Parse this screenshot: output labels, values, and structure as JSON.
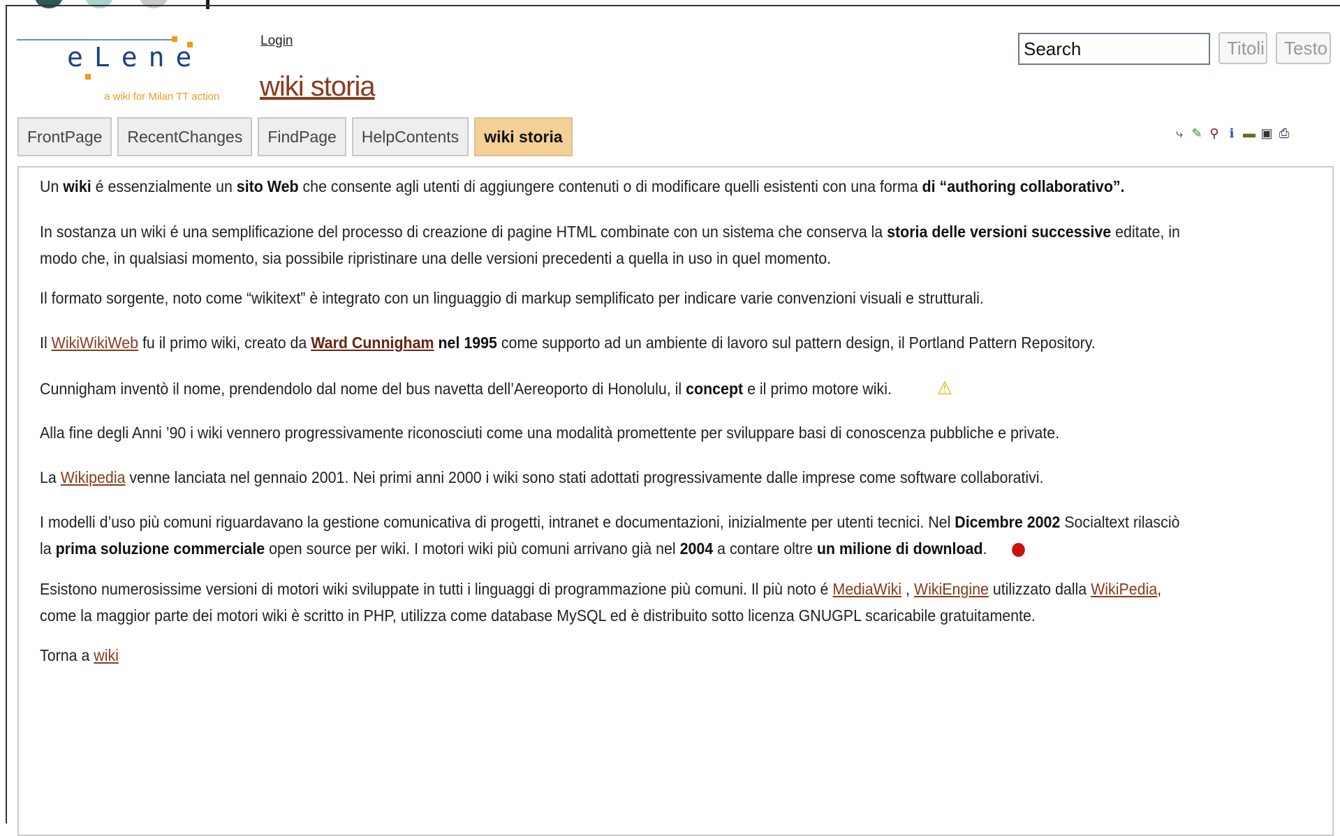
{
  "window": {
    "title": ""
  },
  "header": {
    "logo_text": "eLene",
    "logo_tagline": "a wiki for Milan TT action",
    "login_label": "Login",
    "page_title": "wiki storia"
  },
  "search": {
    "value": "Search",
    "titoli_label": "Titoli",
    "testo_label": "Testo"
  },
  "nav": {
    "tabs": [
      {
        "label": "FrontPage"
      },
      {
        "label": "RecentChanges"
      },
      {
        "label": "FindPage"
      },
      {
        "label": "HelpContents"
      },
      {
        "label": "wiki storia",
        "active": true
      }
    ]
  },
  "toolbar_icons": [
    "subscribe-icon",
    "edit-icon",
    "find-icon",
    "info-icon",
    "attachments-icon",
    "raw-text-icon",
    "print-icon"
  ],
  "content": {
    "p1": {
      "t1": "Un ",
      "b1": "wiki",
      "t2": " é essenzialmente un ",
      "b2": "sito Web",
      "t3": " che consente agli utenti di aggiungere contenuti o di modificare quelli esistenti con una forma ",
      "b3": "di “authoring collaborativo”."
    },
    "p2": {
      "t1": "In sostanza un wiki é una semplificazione del processo di creazione di pagine HTML combinate con un sistema che conserva la ",
      "b1": "storia delle versioni successive",
      "t2": " editate, in",
      "line2": "modo  che, in qualsiasi momento, sia possibile ripristinare una delle versioni precedenti a quella in uso in quel momento."
    },
    "p3": "Il formato sorgente, noto come “wikitext” è integrato con un linguaggio di markup semplificato per indicare varie convenzioni visuali e strutturali.",
    "p4": {
      "t1": "Il ",
      "l1": "WikiWikiWeb",
      "t2": " fu il primo wiki, creato da ",
      "l2": "Ward Cunnigham",
      "b1": " nel 1995",
      "t3": " come supporto ad un ambiente di lavoro sul pattern design, il Portland Pattern Repository."
    },
    "p5": {
      "t1": "Cunnigham inventò il nome, prendendolo dal nome del bus navetta dell’Aereoporto di Honolulu, il ",
      "b1": "concept",
      "t2": " e il primo motore wiki."
    },
    "p6": "Alla fine degli Anni ’90 i wiki vennero progressivamente riconosciuti come una modalità promettente per sviluppare basi di conoscenza pubbliche e private.",
    "p7": {
      "t1": "La ",
      "l1": "Wikipedia",
      "t2": " venne lanciata nel gennaio 2001. Nei primi anni 2000 i wiki sono stati adottati progressivamente dalle imprese come software collaborativi."
    },
    "p8": {
      "t1": "I modelli d’uso più comuni riguardavano la gestione comunicativa di progetti, intranet e documentazioni, inizialmente per utenti tecnici. Nel ",
      "b1": "Dicembre 2002",
      "t2": " Socialtext rilasciò",
      "t3": "la ",
      "b2": "prima soluzione commerciale",
      "t4": " open source per wiki. I motori wiki più comuni arrivano già nel ",
      "b3": "2004",
      "t5": " a contare oltre ",
      "b4": "un milione di download",
      "t6": "."
    },
    "p9": {
      "t1": "Esistono numerosissime versioni di motori wiki sviluppate in tutti i linguaggi di programmazione più comuni. Il più noto é ",
      "l1": "MediaWiki",
      "t2": " , ",
      "l2": "WikiEngine",
      "t3": " utilizzato dalla ",
      "l3": "WikiPedia",
      "t4": ",",
      "line2": "come la maggior parte dei motori wiki è scritto in PHP, utilizza come database MySQL ed è distribuito sotto licenza GNUGPL scaricabile gratuitamente."
    },
    "p10": {
      "t1": "Torna a ",
      "l1": "wiki"
    }
  }
}
